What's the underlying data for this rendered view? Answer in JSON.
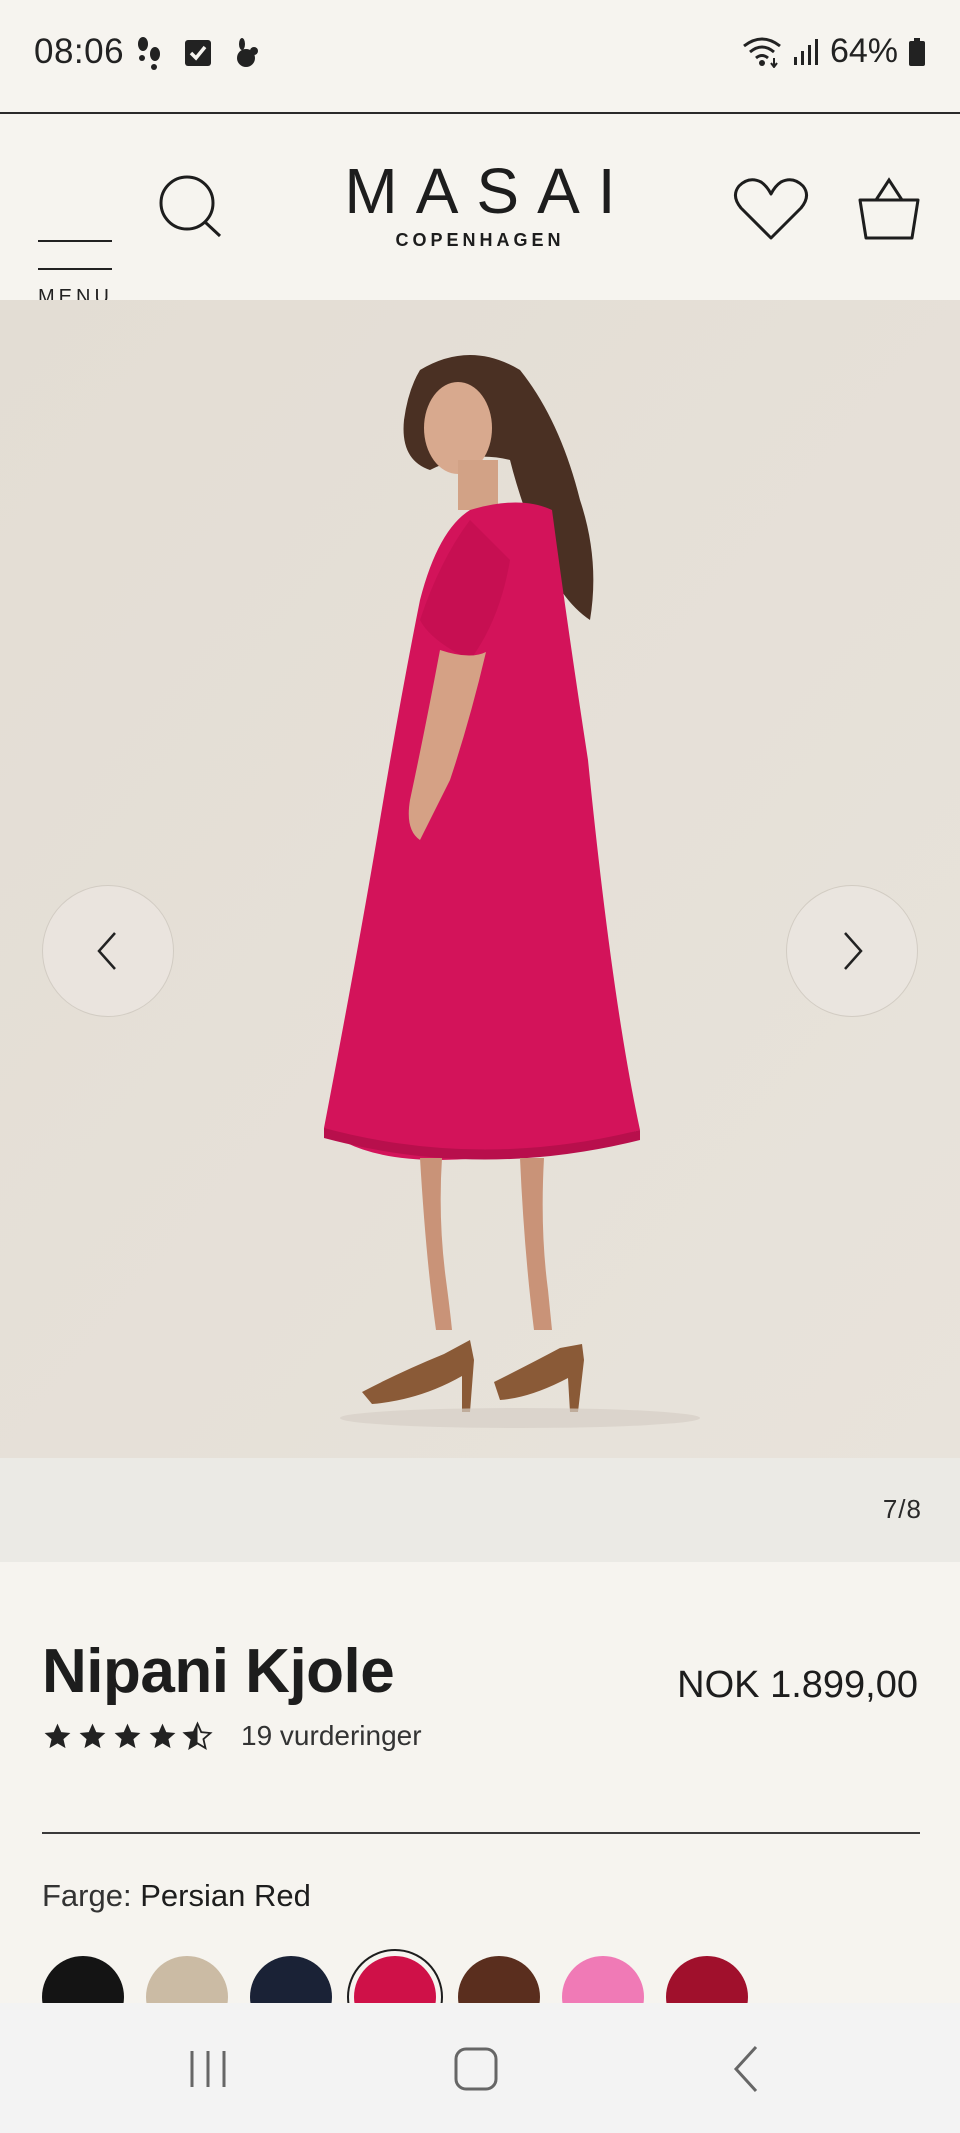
{
  "status_bar": {
    "time": "08:06",
    "battery": "64%",
    "notification_icons": [
      "footsteps-icon",
      "checkbox-icon",
      "rabbit-icon"
    ]
  },
  "header": {
    "menu_label": "MENU",
    "brand_name": "MASAI",
    "brand_sub": "COPENHAGEN"
  },
  "gallery": {
    "counter": "7/8",
    "dress_color": "#d3135a"
  },
  "product": {
    "title": "Nipani Kjole",
    "price": "NOK 1.899,00",
    "rating_value": 4.5,
    "rating_count": "19 vurderinger",
    "color_label": "Farge:",
    "color_value": "Persian Red"
  },
  "swatches": [
    {
      "name": "black",
      "color": "#141414",
      "selected": false
    },
    {
      "name": "beige",
      "color": "#cbbba4",
      "selected": false
    },
    {
      "name": "navy",
      "color": "#1a2236",
      "selected": false
    },
    {
      "name": "persian-red",
      "color": "#cf1148",
      "selected": true
    },
    {
      "name": "brown",
      "color": "#5a2e1e",
      "selected": false
    },
    {
      "name": "pink",
      "color": "#f07ab6",
      "selected": false
    },
    {
      "name": "burgundy",
      "color": "#a0102c",
      "selected": false
    }
  ]
}
